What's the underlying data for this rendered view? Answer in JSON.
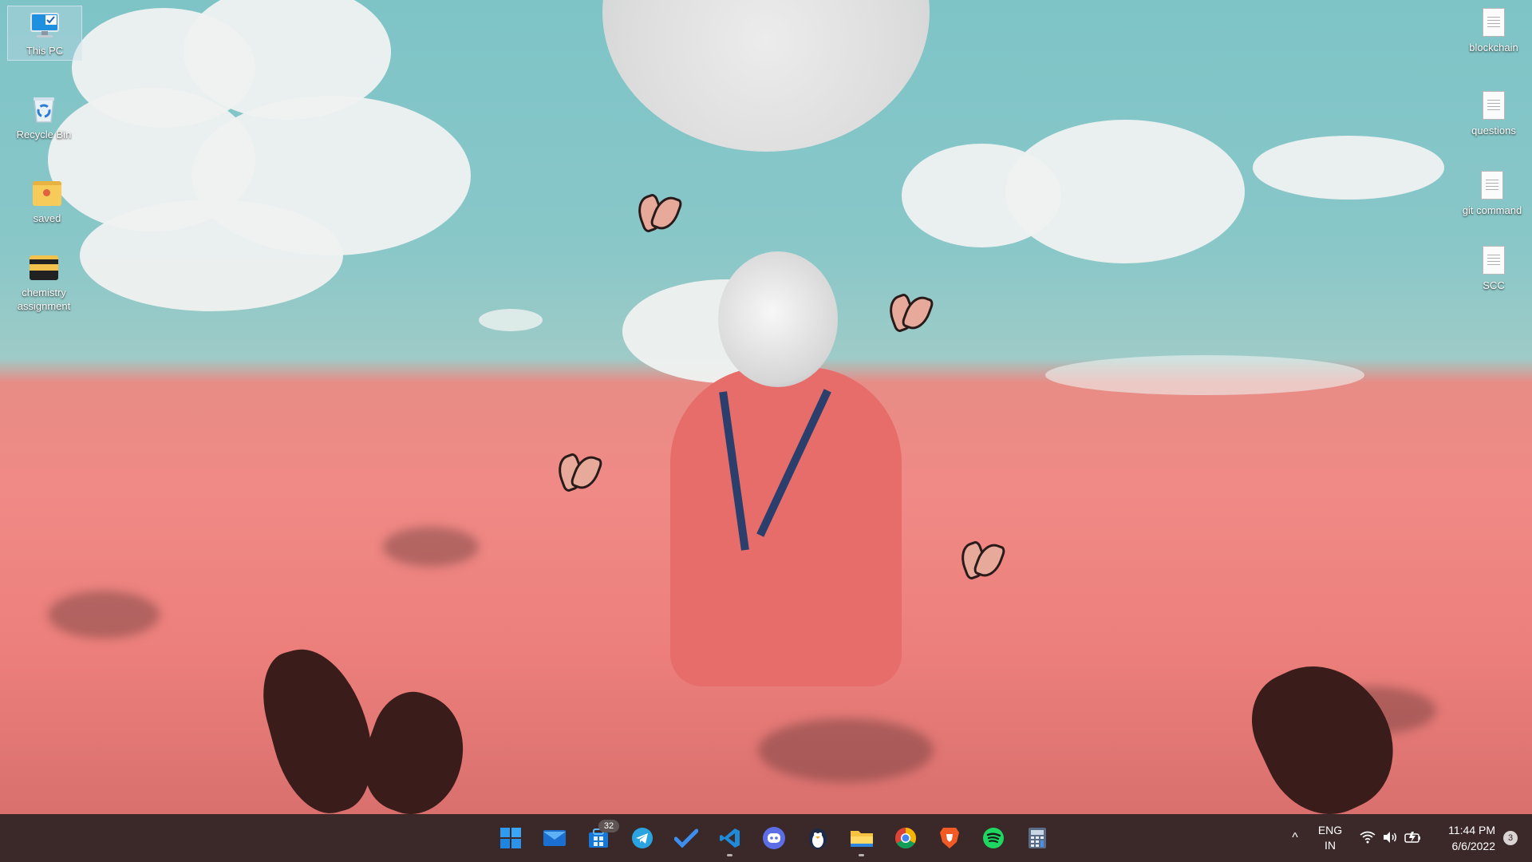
{
  "desktop_icons_left": [
    {
      "label": "This PC",
      "icon": "monitor-icon",
      "selected": true
    },
    {
      "label": "Recycle Bin",
      "icon": "recycle-bin-icon"
    },
    {
      "label": "saved",
      "icon": "folder-icon"
    },
    {
      "label": "chemistry assignment",
      "icon": "folder-dark-icon"
    }
  ],
  "desktop_icons_right": [
    {
      "label": "blockchain",
      "icon": "text-document-icon"
    },
    {
      "label": "questions",
      "icon": "text-document-icon"
    },
    {
      "label": "git command",
      "icon": "text-document-icon"
    },
    {
      "label": "SCC",
      "icon": "text-document-icon"
    }
  ],
  "taskbar": {
    "apps": [
      {
        "name": "start",
        "icon": "windows-start-icon"
      },
      {
        "name": "mail",
        "icon": "mail-icon"
      },
      {
        "name": "apps-store",
        "icon": "store-icon",
        "badge": "32"
      },
      {
        "name": "telegram",
        "icon": "telegram-icon"
      },
      {
        "name": "todo",
        "icon": "checkmark-icon"
      },
      {
        "name": "vscode",
        "icon": "vscode-icon",
        "running": true
      },
      {
        "name": "discord",
        "icon": "discord-icon"
      },
      {
        "name": "penguin",
        "icon": "penguin-icon"
      },
      {
        "name": "file-explorer",
        "icon": "folder-icon",
        "running": true
      },
      {
        "name": "chrome",
        "icon": "chrome-icon"
      },
      {
        "name": "brave",
        "icon": "brave-icon"
      },
      {
        "name": "spotify",
        "icon": "spotify-icon"
      },
      {
        "name": "calculator",
        "icon": "calculator-icon"
      }
    ],
    "tray": {
      "chevron": "^",
      "lang_line1": "ENG",
      "lang_line2": "IN",
      "time": "11:44 PM",
      "date": "6/6/2022",
      "notifications": "3"
    }
  },
  "colors": {
    "taskbar_bg": "#3b2828",
    "accent_blue": "#0078d4"
  }
}
